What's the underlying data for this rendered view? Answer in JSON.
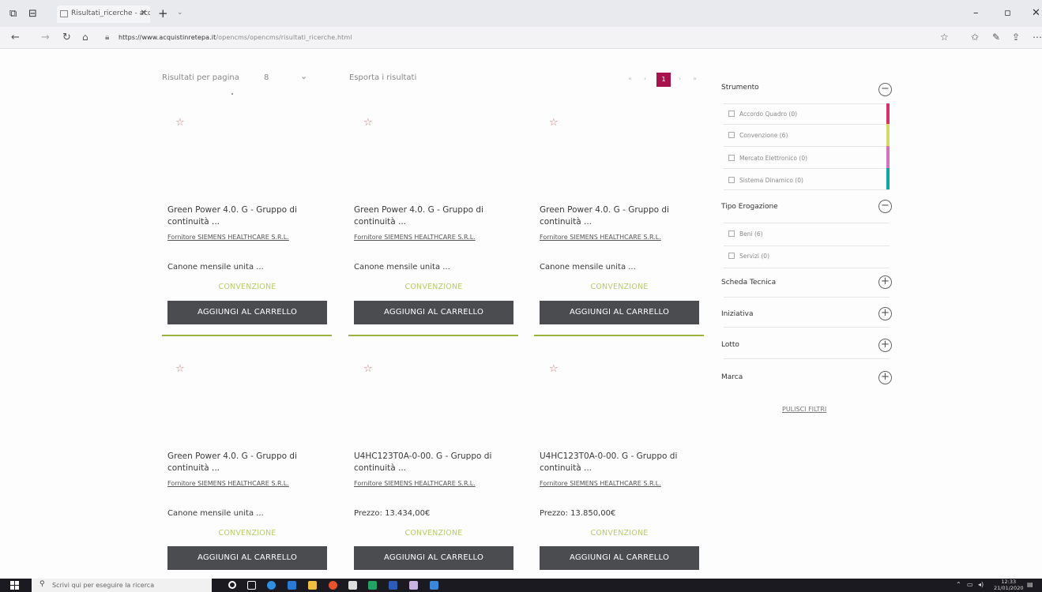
{
  "browser": {
    "tab_title": "Risultati_ricerche - acqui",
    "url_host": "https://www.acquistinretepa.it",
    "url_path": "/opencms/opencms/risultati_ricerche.html",
    "icons": [
      "tabs-icon",
      "back-tabs-icon",
      "close-icon",
      "plus-icon",
      "chevron-down-icon",
      "back-icon",
      "forward-icon",
      "refresh-icon",
      "home-icon",
      "lock-icon",
      "favorite-star-icon",
      "favorites-icon",
      "pen-icon",
      "share-icon",
      "more-icon",
      "minimize-icon",
      "maximize-icon",
      "window-close-icon"
    ]
  },
  "toolbar": {
    "per_page_label": "Risultati per pagina",
    "per_page_value": "8",
    "export_label": "Esporta i risultati",
    "current_page": "1"
  },
  "products": [
    {
      "title": "Green Power 4.0. G - Gruppo di continuità ...",
      "supplier": "Fornitore SIEMENS HEALTHCARE S.R.L.",
      "price": "Canone mensile unita ...",
      "tag": "CONVENZIONE",
      "button": "AGGIUNGI AL CARRELLO"
    },
    {
      "title": "Green Power 4.0. G - Gruppo di continuità ...",
      "supplier": "Fornitore SIEMENS HEALTHCARE S.R.L.",
      "price": "Canone mensile unita ...",
      "tag": "CONVENZIONE",
      "button": "AGGIUNGI AL CARRELLO"
    },
    {
      "title": "Green Power 4.0. G - Gruppo di continuità ...",
      "supplier": "Fornitore SIEMENS HEALTHCARE S.R.L.",
      "price": "Canone mensile unita ...",
      "tag": "CONVENZIONE",
      "button": "AGGIUNGI AL CARRELLO"
    },
    {
      "title": "Green Power 4.0. G - Gruppo di continuità ...",
      "supplier": "Fornitore SIEMENS HEALTHCARE S.R.L.",
      "price": "Canone mensile unita ...",
      "tag": "CONVENZIONE",
      "button": "AGGIUNGI AL CARRELLO"
    },
    {
      "title": "U4HC123T0A-0-00. G - Gruppo di continuità ...",
      "supplier": "Fornitore SIEMENS HEALTHCARE S.R.L.",
      "price": "Prezzo: 13.434,00€",
      "tag": "CONVENZIONE",
      "button": "AGGIUNGI AL CARRELLO"
    },
    {
      "title": "U4HC123T0A-0-00. G - Gruppo di continuità ...",
      "supplier": "Fornitore SIEMENS HEALTHCARE S.R.L.",
      "price": "Prezzo: 13.850,00€",
      "tag": "CONVENZIONE",
      "button": "AGGIUNGI AL CARRELLO"
    }
  ],
  "filters": {
    "strumento": {
      "label": "Strumento",
      "toggle": "−",
      "items": [
        {
          "label": "Accordo Quadro (0)",
          "color": "#d6336c"
        },
        {
          "label": "Convenzione (6)",
          "color": "#d4d96a"
        },
        {
          "label": "Mercato Elettronico (0)",
          "color": "#d873b8"
        },
        {
          "label": "Sistema Dinamico (0)",
          "color": "#12a8a0"
        }
      ]
    },
    "tipo_erogazione": {
      "label": "Tipo Erogazione",
      "toggle": "−",
      "items": [
        {
          "label": "Beni (6)"
        },
        {
          "label": "Servizi (0)"
        }
      ]
    },
    "scheda_tecnica": {
      "label": "Scheda Tecnica",
      "toggle": "+"
    },
    "iniziativa": {
      "label": "Iniziativa",
      "toggle": "+"
    },
    "lotto": {
      "label": "Lotto",
      "toggle": "+"
    },
    "marca": {
      "label": "Marca",
      "toggle": "+"
    },
    "reset_label": "PULISCI FILTRI"
  },
  "taskbar": {
    "search_placeholder": "Scrivi qui per eseguire la ricerca",
    "time": "12:33",
    "date": "21/01/2020"
  }
}
